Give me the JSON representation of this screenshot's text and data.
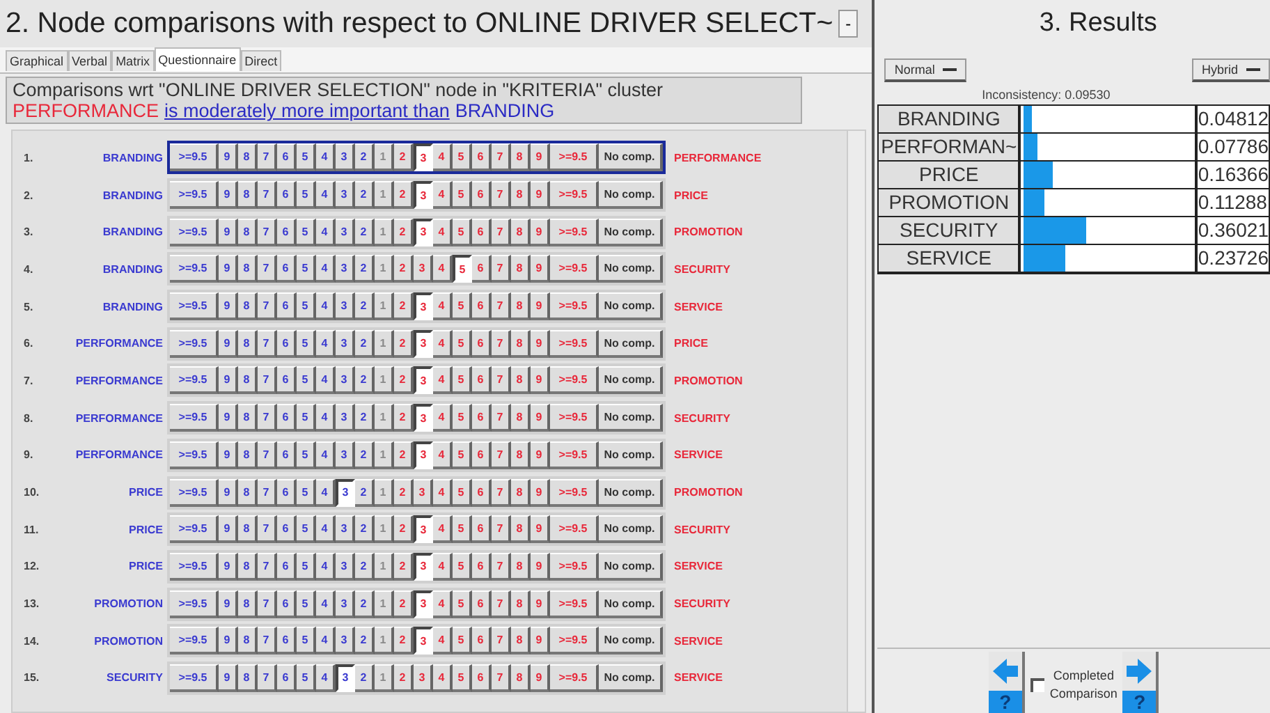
{
  "title": "2. Node comparisons with respect to ONLINE DRIVER SELECT~",
  "title_button": "-",
  "tabs": [
    {
      "label": "Graphical",
      "selected": false
    },
    {
      "label": "Verbal",
      "selected": false
    },
    {
      "label": "Matrix",
      "selected": false
    },
    {
      "label": "Questionnaire",
      "selected": true
    },
    {
      "label": "Direct",
      "selected": false
    }
  ],
  "info": {
    "line_1": "Comparisons wrt \"ONLINE DRIVER SELECTION\" node in \"KRITERIA\" cluster",
    "winner": "PERFORMANCE",
    "phrase": "is moderately more important than",
    "loser": "BRANDING"
  },
  "rows": [
    {
      "number": "1.",
      "left": "BRANDING",
      "right": "PERFORMANCE",
      "focused": true,
      "cells": [
        {
          "label": ">=9.5",
          "selected": false
        },
        {
          "label": "9",
          "selected": false
        },
        {
          "label": "8",
          "selected": false
        },
        {
          "label": "7",
          "selected": false
        },
        {
          "label": "6",
          "selected": false
        },
        {
          "label": "5",
          "selected": false
        },
        {
          "label": "4",
          "selected": false
        },
        {
          "label": "3",
          "selected": false
        },
        {
          "label": "2",
          "selected": false
        },
        {
          "label": "1",
          "selected": false
        },
        {
          "label": "2",
          "selected": false
        },
        {
          "label": "3",
          "selected": true
        },
        {
          "label": "4",
          "selected": false
        },
        {
          "label": "5",
          "selected": false
        },
        {
          "label": "6",
          "selected": false
        },
        {
          "label": "7",
          "selected": false
        },
        {
          "label": "8",
          "selected": false
        },
        {
          "label": "9",
          "selected": false
        },
        {
          "label": ">=9.5",
          "selected": false
        },
        {
          "label": "No comp.",
          "selected": false
        }
      ]
    },
    {
      "number": "2.",
      "left": "BRANDING",
      "right": "PRICE",
      "focused": false,
      "cells": [
        {
          "label": ">=9.5",
          "selected": false
        },
        {
          "label": "9",
          "selected": false
        },
        {
          "label": "8",
          "selected": false
        },
        {
          "label": "7",
          "selected": false
        },
        {
          "label": "6",
          "selected": false
        },
        {
          "label": "5",
          "selected": false
        },
        {
          "label": "4",
          "selected": false
        },
        {
          "label": "3",
          "selected": false
        },
        {
          "label": "2",
          "selected": false
        },
        {
          "label": "1",
          "selected": false
        },
        {
          "label": "2",
          "selected": false
        },
        {
          "label": "3",
          "selected": true
        },
        {
          "label": "4",
          "selected": false
        },
        {
          "label": "5",
          "selected": false
        },
        {
          "label": "6",
          "selected": false
        },
        {
          "label": "7",
          "selected": false
        },
        {
          "label": "8",
          "selected": false
        },
        {
          "label": "9",
          "selected": false
        },
        {
          "label": ">=9.5",
          "selected": false
        },
        {
          "label": "No comp.",
          "selected": false
        }
      ]
    },
    {
      "number": "3.",
      "left": "BRANDING",
      "right": "PROMOTION",
      "focused": false,
      "cells": [
        {
          "label": ">=9.5",
          "selected": false
        },
        {
          "label": "9",
          "selected": false
        },
        {
          "label": "8",
          "selected": false
        },
        {
          "label": "7",
          "selected": false
        },
        {
          "label": "6",
          "selected": false
        },
        {
          "label": "5",
          "selected": false
        },
        {
          "label": "4",
          "selected": false
        },
        {
          "label": "3",
          "selected": false
        },
        {
          "label": "2",
          "selected": false
        },
        {
          "label": "1",
          "selected": false
        },
        {
          "label": "2",
          "selected": false
        },
        {
          "label": "3",
          "selected": true
        },
        {
          "label": "4",
          "selected": false
        },
        {
          "label": "5",
          "selected": false
        },
        {
          "label": "6",
          "selected": false
        },
        {
          "label": "7",
          "selected": false
        },
        {
          "label": "8",
          "selected": false
        },
        {
          "label": "9",
          "selected": false
        },
        {
          "label": ">=9.5",
          "selected": false
        },
        {
          "label": "No comp.",
          "selected": false
        }
      ]
    },
    {
      "number": "4.",
      "left": "BRANDING",
      "right": "SECURITY",
      "focused": false,
      "cells": [
        {
          "label": ">=9.5",
          "selected": false
        },
        {
          "label": "9",
          "selected": false
        },
        {
          "label": "8",
          "selected": false
        },
        {
          "label": "7",
          "selected": false
        },
        {
          "label": "6",
          "selected": false
        },
        {
          "label": "5",
          "selected": false
        },
        {
          "label": "4",
          "selected": false
        },
        {
          "label": "3",
          "selected": false
        },
        {
          "label": "2",
          "selected": false
        },
        {
          "label": "1",
          "selected": false
        },
        {
          "label": "2",
          "selected": false
        },
        {
          "label": "3",
          "selected": false
        },
        {
          "label": "4",
          "selected": false
        },
        {
          "label": "5",
          "selected": true
        },
        {
          "label": "6",
          "selected": false
        },
        {
          "label": "7",
          "selected": false
        },
        {
          "label": "8",
          "selected": false
        },
        {
          "label": "9",
          "selected": false
        },
        {
          "label": ">=9.5",
          "selected": false
        },
        {
          "label": "No comp.",
          "selected": false
        }
      ]
    },
    {
      "number": "5.",
      "left": "BRANDING",
      "right": "SERVICE",
      "focused": false,
      "cells": [
        {
          "label": ">=9.5",
          "selected": false
        },
        {
          "label": "9",
          "selected": false
        },
        {
          "label": "8",
          "selected": false
        },
        {
          "label": "7",
          "selected": false
        },
        {
          "label": "6",
          "selected": false
        },
        {
          "label": "5",
          "selected": false
        },
        {
          "label": "4",
          "selected": false
        },
        {
          "label": "3",
          "selected": false
        },
        {
          "label": "2",
          "selected": false
        },
        {
          "label": "1",
          "selected": false
        },
        {
          "label": "2",
          "selected": false
        },
        {
          "label": "3",
          "selected": true
        },
        {
          "label": "4",
          "selected": false
        },
        {
          "label": "5",
          "selected": false
        },
        {
          "label": "6",
          "selected": false
        },
        {
          "label": "7",
          "selected": false
        },
        {
          "label": "8",
          "selected": false
        },
        {
          "label": "9",
          "selected": false
        },
        {
          "label": ">=9.5",
          "selected": false
        },
        {
          "label": "No comp.",
          "selected": false
        }
      ]
    },
    {
      "number": "6.",
      "left": "PERFORMANCE",
      "right": "PRICE",
      "focused": false,
      "cells": [
        {
          "label": ">=9.5",
          "selected": false
        },
        {
          "label": "9",
          "selected": false
        },
        {
          "label": "8",
          "selected": false
        },
        {
          "label": "7",
          "selected": false
        },
        {
          "label": "6",
          "selected": false
        },
        {
          "label": "5",
          "selected": false
        },
        {
          "label": "4",
          "selected": false
        },
        {
          "label": "3",
          "selected": false
        },
        {
          "label": "2",
          "selected": false
        },
        {
          "label": "1",
          "selected": false
        },
        {
          "label": "2",
          "selected": false
        },
        {
          "label": "3",
          "selected": true
        },
        {
          "label": "4",
          "selected": false
        },
        {
          "label": "5",
          "selected": false
        },
        {
          "label": "6",
          "selected": false
        },
        {
          "label": "7",
          "selected": false
        },
        {
          "label": "8",
          "selected": false
        },
        {
          "label": "9",
          "selected": false
        },
        {
          "label": ">=9.5",
          "selected": false
        },
        {
          "label": "No comp.",
          "selected": false
        }
      ]
    },
    {
      "number": "7.",
      "left": "PERFORMANCE",
      "right": "PROMOTION",
      "focused": false,
      "cells": [
        {
          "label": ">=9.5",
          "selected": false
        },
        {
          "label": "9",
          "selected": false
        },
        {
          "label": "8",
          "selected": false
        },
        {
          "label": "7",
          "selected": false
        },
        {
          "label": "6",
          "selected": false
        },
        {
          "label": "5",
          "selected": false
        },
        {
          "label": "4",
          "selected": false
        },
        {
          "label": "3",
          "selected": false
        },
        {
          "label": "2",
          "selected": false
        },
        {
          "label": "1",
          "selected": false
        },
        {
          "label": "2",
          "selected": false
        },
        {
          "label": "3",
          "selected": true
        },
        {
          "label": "4",
          "selected": false
        },
        {
          "label": "5",
          "selected": false
        },
        {
          "label": "6",
          "selected": false
        },
        {
          "label": "7",
          "selected": false
        },
        {
          "label": "8",
          "selected": false
        },
        {
          "label": "9",
          "selected": false
        },
        {
          "label": ">=9.5",
          "selected": false
        },
        {
          "label": "No comp.",
          "selected": false
        }
      ]
    },
    {
      "number": "8.",
      "left": "PERFORMANCE",
      "right": "SECURITY",
      "focused": false,
      "cells": [
        {
          "label": ">=9.5",
          "selected": false
        },
        {
          "label": "9",
          "selected": false
        },
        {
          "label": "8",
          "selected": false
        },
        {
          "label": "7",
          "selected": false
        },
        {
          "label": "6",
          "selected": false
        },
        {
          "label": "5",
          "selected": false
        },
        {
          "label": "4",
          "selected": false
        },
        {
          "label": "3",
          "selected": false
        },
        {
          "label": "2",
          "selected": false
        },
        {
          "label": "1",
          "selected": false
        },
        {
          "label": "2",
          "selected": false
        },
        {
          "label": "3",
          "selected": true
        },
        {
          "label": "4",
          "selected": false
        },
        {
          "label": "5",
          "selected": false
        },
        {
          "label": "6",
          "selected": false
        },
        {
          "label": "7",
          "selected": false
        },
        {
          "label": "8",
          "selected": false
        },
        {
          "label": "9",
          "selected": false
        },
        {
          "label": ">=9.5",
          "selected": false
        },
        {
          "label": "No comp.",
          "selected": false
        }
      ]
    },
    {
      "number": "9.",
      "left": "PERFORMANCE",
      "right": "SERVICE",
      "focused": false,
      "cells": [
        {
          "label": ">=9.5",
          "selected": false
        },
        {
          "label": "9",
          "selected": false
        },
        {
          "label": "8",
          "selected": false
        },
        {
          "label": "7",
          "selected": false
        },
        {
          "label": "6",
          "selected": false
        },
        {
          "label": "5",
          "selected": false
        },
        {
          "label": "4",
          "selected": false
        },
        {
          "label": "3",
          "selected": false
        },
        {
          "label": "2",
          "selected": false
        },
        {
          "label": "1",
          "selected": false
        },
        {
          "label": "2",
          "selected": false
        },
        {
          "label": "3",
          "selected": true
        },
        {
          "label": "4",
          "selected": false
        },
        {
          "label": "5",
          "selected": false
        },
        {
          "label": "6",
          "selected": false
        },
        {
          "label": "7",
          "selected": false
        },
        {
          "label": "8",
          "selected": false
        },
        {
          "label": "9",
          "selected": false
        },
        {
          "label": ">=9.5",
          "selected": false
        },
        {
          "label": "No comp.",
          "selected": false
        }
      ]
    },
    {
      "number": "10.",
      "left": "PRICE",
      "right": "PROMOTION",
      "focused": false,
      "cells": [
        {
          "label": ">=9.5",
          "selected": false
        },
        {
          "label": "9",
          "selected": false
        },
        {
          "label": "8",
          "selected": false
        },
        {
          "label": "7",
          "selected": false
        },
        {
          "label": "6",
          "selected": false
        },
        {
          "label": "5",
          "selected": false
        },
        {
          "label": "4",
          "selected": false
        },
        {
          "label": "3",
          "selected": true
        },
        {
          "label": "2",
          "selected": false
        },
        {
          "label": "1",
          "selected": false
        },
        {
          "label": "2",
          "selected": false
        },
        {
          "label": "3",
          "selected": false
        },
        {
          "label": "4",
          "selected": false
        },
        {
          "label": "5",
          "selected": false
        },
        {
          "label": "6",
          "selected": false
        },
        {
          "label": "7",
          "selected": false
        },
        {
          "label": "8",
          "selected": false
        },
        {
          "label": "9",
          "selected": false
        },
        {
          "label": ">=9.5",
          "selected": false
        },
        {
          "label": "No comp.",
          "selected": false
        }
      ]
    },
    {
      "number": "11.",
      "left": "PRICE",
      "right": "SECURITY",
      "focused": false,
      "cells": [
        {
          "label": ">=9.5",
          "selected": false
        },
        {
          "label": "9",
          "selected": false
        },
        {
          "label": "8",
          "selected": false
        },
        {
          "label": "7",
          "selected": false
        },
        {
          "label": "6",
          "selected": false
        },
        {
          "label": "5",
          "selected": false
        },
        {
          "label": "4",
          "selected": false
        },
        {
          "label": "3",
          "selected": false
        },
        {
          "label": "2",
          "selected": false
        },
        {
          "label": "1",
          "selected": false
        },
        {
          "label": "2",
          "selected": false
        },
        {
          "label": "3",
          "selected": true
        },
        {
          "label": "4",
          "selected": false
        },
        {
          "label": "5",
          "selected": false
        },
        {
          "label": "6",
          "selected": false
        },
        {
          "label": "7",
          "selected": false
        },
        {
          "label": "8",
          "selected": false
        },
        {
          "label": "9",
          "selected": false
        },
        {
          "label": ">=9.5",
          "selected": false
        },
        {
          "label": "No comp.",
          "selected": false
        }
      ]
    },
    {
      "number": "12.",
      "left": "PRICE",
      "right": "SERVICE",
      "focused": false,
      "cells": [
        {
          "label": ">=9.5",
          "selected": false
        },
        {
          "label": "9",
          "selected": false
        },
        {
          "label": "8",
          "selected": false
        },
        {
          "label": "7",
          "selected": false
        },
        {
          "label": "6",
          "selected": false
        },
        {
          "label": "5",
          "selected": false
        },
        {
          "label": "4",
          "selected": false
        },
        {
          "label": "3",
          "selected": false
        },
        {
          "label": "2",
          "selected": false
        },
        {
          "label": "1",
          "selected": false
        },
        {
          "label": "2",
          "selected": false
        },
        {
          "label": "3",
          "selected": true
        },
        {
          "label": "4",
          "selected": false
        },
        {
          "label": "5",
          "selected": false
        },
        {
          "label": "6",
          "selected": false
        },
        {
          "label": "7",
          "selected": false
        },
        {
          "label": "8",
          "selected": false
        },
        {
          "label": "9",
          "selected": false
        },
        {
          "label": ">=9.5",
          "selected": false
        },
        {
          "label": "No comp.",
          "selected": false
        }
      ]
    },
    {
      "number": "13.",
      "left": "PROMOTION",
      "right": "SECURITY",
      "focused": false,
      "cells": [
        {
          "label": ">=9.5",
          "selected": false
        },
        {
          "label": "9",
          "selected": false
        },
        {
          "label": "8",
          "selected": false
        },
        {
          "label": "7",
          "selected": false
        },
        {
          "label": "6",
          "selected": false
        },
        {
          "label": "5",
          "selected": false
        },
        {
          "label": "4",
          "selected": false
        },
        {
          "label": "3",
          "selected": false
        },
        {
          "label": "2",
          "selected": false
        },
        {
          "label": "1",
          "selected": false
        },
        {
          "label": "2",
          "selected": false
        },
        {
          "label": "3",
          "selected": true
        },
        {
          "label": "4",
          "selected": false
        },
        {
          "label": "5",
          "selected": false
        },
        {
          "label": "6",
          "selected": false
        },
        {
          "label": "7",
          "selected": false
        },
        {
          "label": "8",
          "selected": false
        },
        {
          "label": "9",
          "selected": false
        },
        {
          "label": ">=9.5",
          "selected": false
        },
        {
          "label": "No comp.",
          "selected": false
        }
      ]
    },
    {
      "number": "14.",
      "left": "PROMOTION",
      "right": "SERVICE",
      "focused": false,
      "cells": [
        {
          "label": ">=9.5",
          "selected": false
        },
        {
          "label": "9",
          "selected": false
        },
        {
          "label": "8",
          "selected": false
        },
        {
          "label": "7",
          "selected": false
        },
        {
          "label": "6",
          "selected": false
        },
        {
          "label": "5",
          "selected": false
        },
        {
          "label": "4",
          "selected": false
        },
        {
          "label": "3",
          "selected": false
        },
        {
          "label": "2",
          "selected": false
        },
        {
          "label": "1",
          "selected": false
        },
        {
          "label": "2",
          "selected": false
        },
        {
          "label": "3",
          "selected": true
        },
        {
          "label": "4",
          "selected": false
        },
        {
          "label": "5",
          "selected": false
        },
        {
          "label": "6",
          "selected": false
        },
        {
          "label": "7",
          "selected": false
        },
        {
          "label": "8",
          "selected": false
        },
        {
          "label": "9",
          "selected": false
        },
        {
          "label": ">=9.5",
          "selected": false
        },
        {
          "label": "No comp.",
          "selected": false
        }
      ]
    },
    {
      "number": "15.",
      "left": "SECURITY",
      "right": "SERVICE",
      "focused": false,
      "cells": [
        {
          "label": ">=9.5",
          "selected": false
        },
        {
          "label": "9",
          "selected": false
        },
        {
          "label": "8",
          "selected": false
        },
        {
          "label": "7",
          "selected": false
        },
        {
          "label": "6",
          "selected": false
        },
        {
          "label": "5",
          "selected": false
        },
        {
          "label": "4",
          "selected": false
        },
        {
          "label": "3",
          "selected": true
        },
        {
          "label": "2",
          "selected": false
        },
        {
          "label": "1",
          "selected": false
        },
        {
          "label": "2",
          "selected": false
        },
        {
          "label": "3",
          "selected": false
        },
        {
          "label": "4",
          "selected": false
        },
        {
          "label": "5",
          "selected": false
        },
        {
          "label": "6",
          "selected": false
        },
        {
          "label": "7",
          "selected": false
        },
        {
          "label": "8",
          "selected": false
        },
        {
          "label": "9",
          "selected": false
        },
        {
          "label": ">=9.5",
          "selected": false
        },
        {
          "label": "No comp.",
          "selected": false
        }
      ]
    }
  ],
  "results": {
    "title": "3. Results",
    "mode": "Normal",
    "method": "Hybrid",
    "inconsistency": "Inconsistency: 0.09530",
    "items": [
      {
        "name": "BRANDING",
        "level": 0.048,
        "value": "0.04812"
      },
      {
        "name": "PERFORMAN~",
        "level": 0.078,
        "value": "0.07786"
      },
      {
        "name": "PRICE",
        "level": 0.164,
        "value": "0.16366"
      },
      {
        "name": "PROMOTION",
        "level": 0.113,
        "value": "0.11288"
      },
      {
        "name": "SECURITY",
        "level": 0.36,
        "value": "0.36021"
      },
      {
        "name": "SERVICE",
        "level": 0.237,
        "value": "0.23726"
      }
    ]
  },
  "footer": {
    "completed": {
      "label_1": "Completed",
      "label_2": "Comparison",
      "checked": false
    },
    "help_left": "?",
    "help_right": "?"
  }
}
